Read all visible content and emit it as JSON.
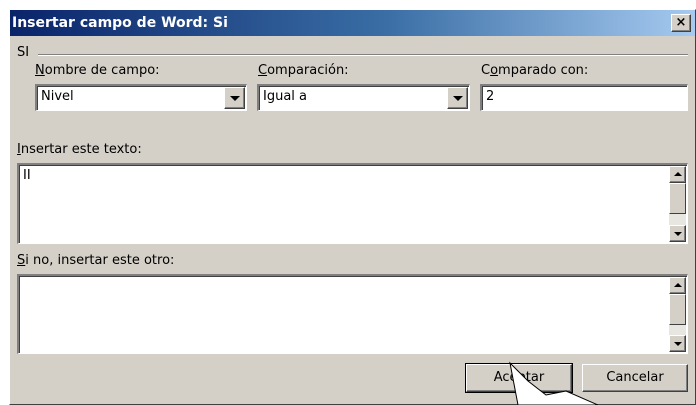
{
  "dialog": {
    "title": "Insertar campo de Word: Si",
    "close_glyph": "×"
  },
  "group": {
    "label": "SI"
  },
  "fields": {
    "field_name": {
      "label_hot": "N",
      "label_rest": "ombre de campo:",
      "value": "Nivel"
    },
    "comparison": {
      "label_hot": "C",
      "label_rest": "omparación:",
      "value": "Igual a"
    },
    "compare_to": {
      "label_pre": "C",
      "label_hot": "o",
      "label_rest": "mparado con:",
      "value": "2"
    }
  },
  "insert_text": {
    "label_hot": "I",
    "label_rest": "nsertar este texto:",
    "value": "II"
  },
  "else_text": {
    "label_hot": "S",
    "label_rest": "i no, insertar este otro:",
    "value": ""
  },
  "buttons": {
    "ok": "Aceptar",
    "cancel": "Cancelar"
  },
  "icons": [
    "close-icon",
    "chevron-down-icon",
    "scroll-up-icon",
    "scroll-down-icon",
    "mouse-pointer-icon"
  ],
  "colors": {
    "title_start": "#0a246a",
    "title_end": "#a6caf0",
    "face": "#d4d0c8"
  }
}
